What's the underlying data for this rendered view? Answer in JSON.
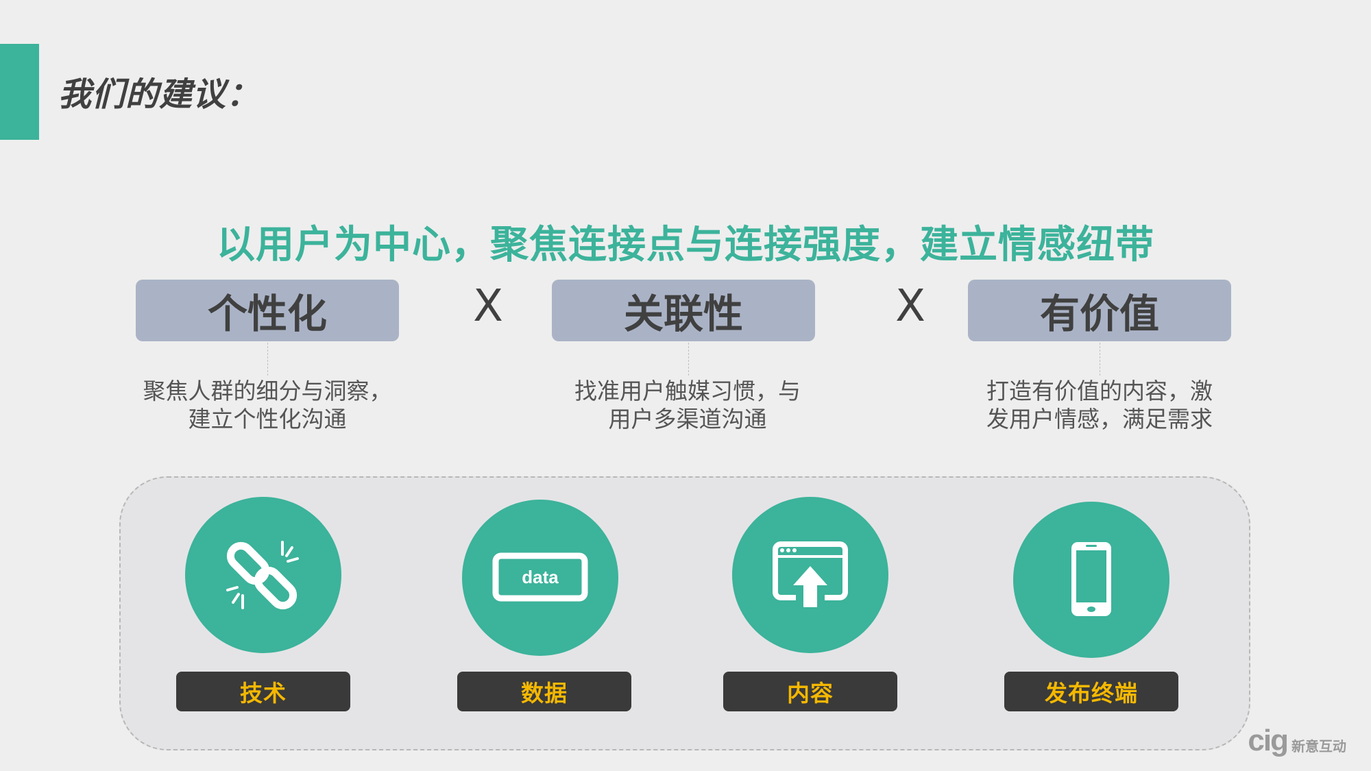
{
  "title": "我们的建议：",
  "headline": "以用户为中心，聚焦连接点与连接强度，建立情感纽带",
  "operator": "X",
  "pillars": [
    {
      "label": "个性化",
      "desc_line1": "聚焦人群的细分与洞察，",
      "desc_line2": "建立个性化沟通"
    },
    {
      "label": "关联性",
      "desc_line1": "找准用户触媒习惯，与",
      "desc_line2": "用户多渠道沟通"
    },
    {
      "label": "有价值",
      "desc_line1": "打造有价值的内容，激",
      "desc_line2": "发用户情感，满足需求"
    }
  ],
  "features": [
    {
      "label": "技术",
      "icon": "broken-link-icon"
    },
    {
      "label": "数据",
      "icon": "data-screen-icon",
      "icon_text": "data"
    },
    {
      "label": "内容",
      "icon": "upload-window-icon"
    },
    {
      "label": "发布终端",
      "icon": "smartphone-icon"
    }
  ],
  "logo": {
    "mark": "cig",
    "text": "新意互动"
  },
  "colors": {
    "accent": "#3cb39b",
    "pillar_bg": "#aab3c6",
    "label_bg": "#3a3a3a",
    "label_text": "#f5b800",
    "background": "#eeeeee"
  }
}
